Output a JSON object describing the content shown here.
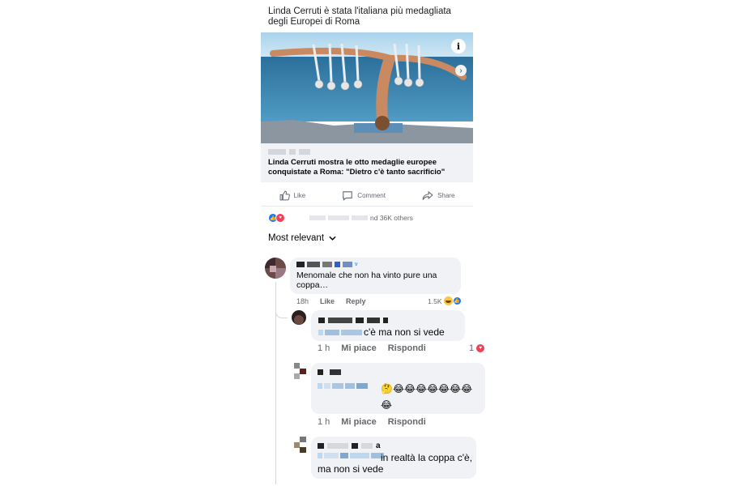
{
  "post": {
    "text": "Linda Cerruti è stata l'italiana più medagliata degli Europei di Roma",
    "link_title": "Linda Cerruti mostra le otto medaglie europee conquistate a Roma: \"Dietro c'è tanto sacrificio\"",
    "info_icon": "info-icon",
    "next_icon": "chevron-right-icon"
  },
  "actions": {
    "like": "Like",
    "comment": "Comment",
    "share": "Share"
  },
  "reactions": {
    "summary": "nd 36K others",
    "icons": [
      "like-icon",
      "love-icon"
    ]
  },
  "sort": {
    "label": "Most relevant"
  },
  "comments": [
    {
      "text": "Menomale che non ha vinto pure una coppa…",
      "time": "18h",
      "like": "Like",
      "reply": "Reply",
      "count": "1.5K"
    },
    {
      "text": "c'è ma non si vede",
      "time": "1 h",
      "like": "Mi piace",
      "reply": "Rispondi",
      "count": "1"
    },
    {
      "text": "🤔😂😂😂😂😂😂😂😂",
      "time": "1 h",
      "like": "Mi piace",
      "reply": "Rispondi"
    },
    {
      "name_suffix": "a",
      "text": "in realtà la coppa c'è, ma non si vede"
    }
  ],
  "colors": {
    "fb_blue": "#1877f2",
    "love_red": "#f33e58",
    "bubble": "#f0f2f5",
    "meta_gray": "#65676b"
  }
}
